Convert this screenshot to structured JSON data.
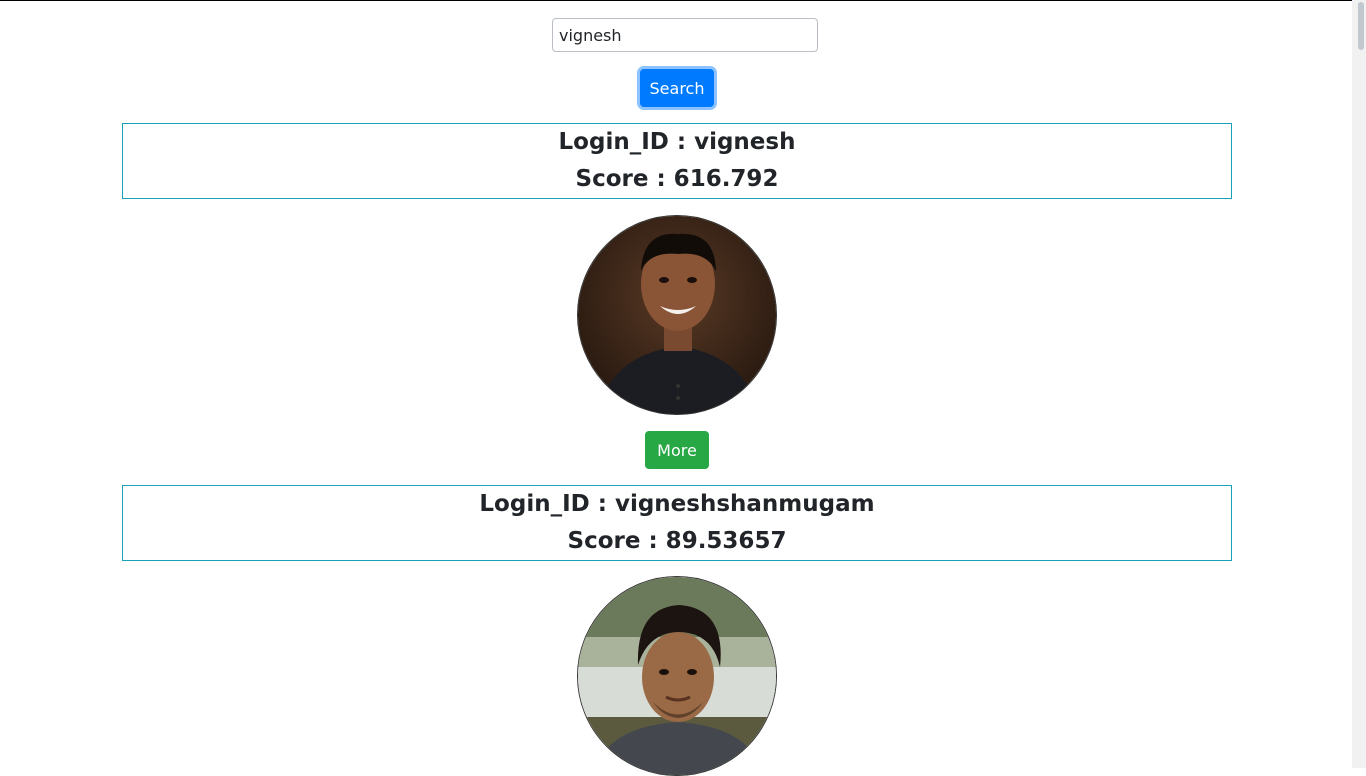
{
  "search": {
    "value": "vignesh",
    "button_label": "Search"
  },
  "results": [
    {
      "login_id_text": "Login_ID : vignesh",
      "score_text": "Score : 616.792",
      "more_label": "More"
    },
    {
      "login_id_text": "Login_ID : vigneshshanmugam",
      "score_text": "Score : 89.53657"
    }
  ],
  "colors": {
    "primary": "#007bff",
    "success": "#28a745",
    "card_border": "#17a2b8"
  }
}
